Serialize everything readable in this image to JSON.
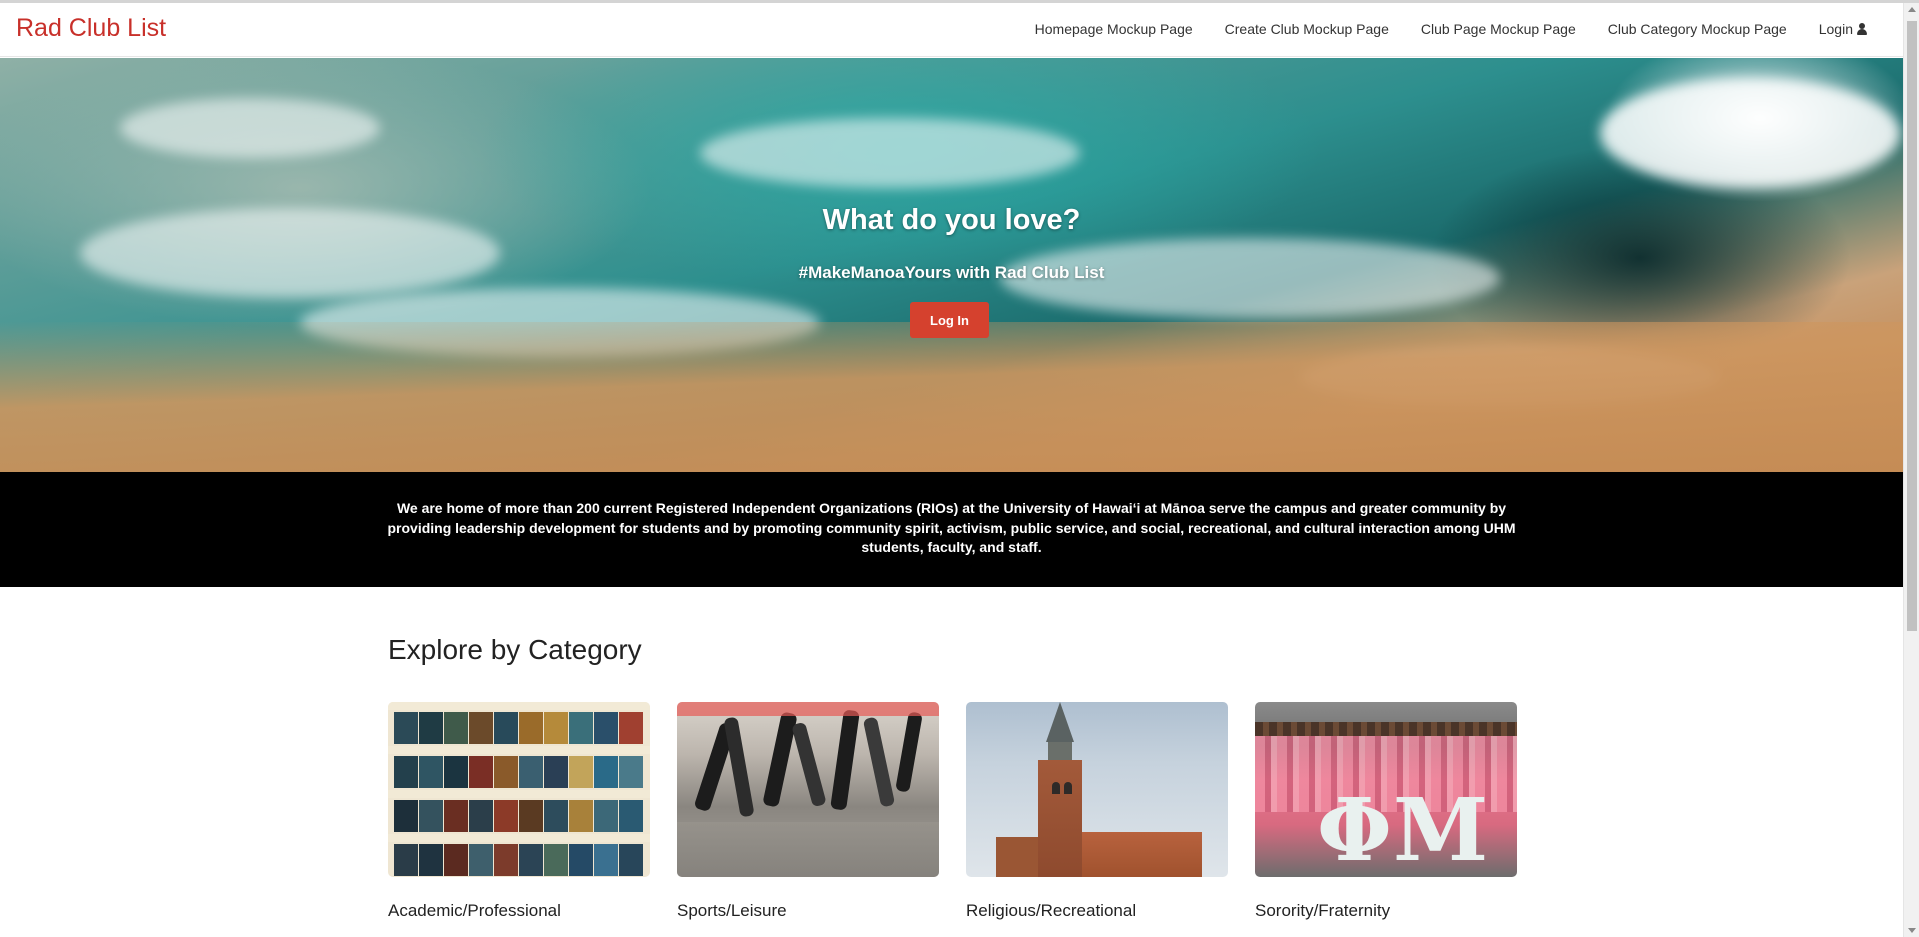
{
  "navbar": {
    "brand": "Rad Club List",
    "items": [
      {
        "label": "Homepage Mockup Page"
      },
      {
        "label": "Create Club Mockup Page"
      },
      {
        "label": "Club Page Mockup Page"
      },
      {
        "label": "Club Category Mockup Page"
      },
      {
        "label": "Login",
        "icon": "user-icon"
      }
    ]
  },
  "hero": {
    "title": "What do you love?",
    "subtitle": "#MakeManoaYours with Rad Club List",
    "button_label": "Log In"
  },
  "banner": {
    "text": "We are home of more than 200 current Registered Independent Organizations (RIOs) at the University of Hawaiʻi at Mānoa serve the campus and greater community by providing leadership development for students and by promoting community spirit, activism, public service, and social, recreational, and cultural interaction among UHM students, faculty, and staff."
  },
  "categories": {
    "title": "Explore by Category",
    "items": [
      {
        "label": "Academic/Professional"
      },
      {
        "label": "Sports/Leisure"
      },
      {
        "label": "Religious/Recreational"
      },
      {
        "label": "Sorority/Fraternity"
      }
    ]
  },
  "colors": {
    "brand": "#c8302a",
    "button": "#d5412e",
    "banner_bg": "#000000"
  }
}
